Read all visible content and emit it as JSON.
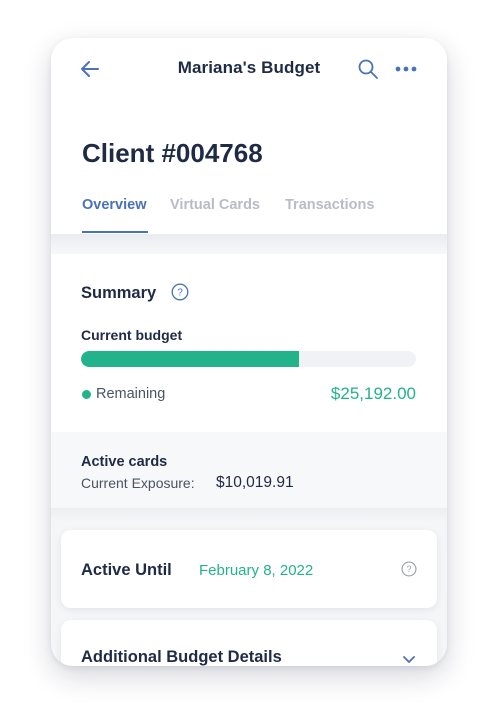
{
  "header": {
    "title": "Mariana's Budget",
    "back_icon": "arrow-left-icon",
    "search_icon": "search-icon",
    "more_icon": "more-horizontal-icon"
  },
  "client": {
    "title": "Client #004768"
  },
  "tabs": [
    {
      "label": "Overview",
      "active": true
    },
    {
      "label": "Virtual Cards",
      "active": false
    },
    {
      "label": "Transactions",
      "active": false
    }
  ],
  "summary": {
    "title": "Summary",
    "budget_label": "Current budget",
    "progress_fraction": 0.65,
    "remaining_label": "Remaining",
    "remaining_value": "$25,192.00"
  },
  "active_cards": {
    "title": "Active cards",
    "exposure_label": "Current Exposure:",
    "exposure_value": "$10,019.91"
  },
  "active_until": {
    "label": "Active Until",
    "date": "February 8, 2022"
  },
  "details": {
    "label": "Additional Budget Details"
  },
  "colors": {
    "accent_blue": "#4a72b8",
    "accent_green": "#22b38a",
    "text_dark": "#1f2a44",
    "tab_inactive": "#b7bcc6"
  }
}
